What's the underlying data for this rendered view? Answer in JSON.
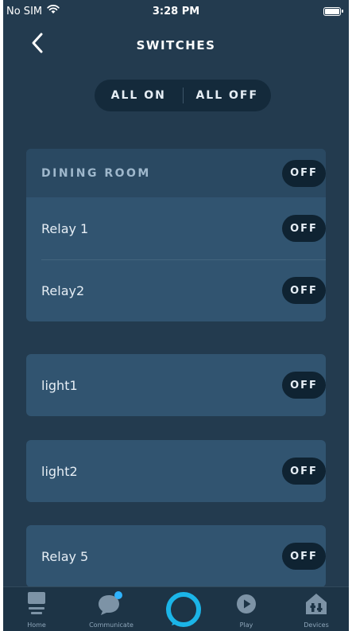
{
  "status_bar": {
    "carrier": "No SIM",
    "time": "3:28 PM"
  },
  "nav": {
    "title": "SWITCHES"
  },
  "all_controls": {
    "all_on": "ALL ON",
    "all_off": "ALL OFF"
  },
  "groups": [
    {
      "title": "DINING ROOM",
      "state": "OFF",
      "items": [
        {
          "label": "Relay 1",
          "state": "OFF"
        },
        {
          "label": "Relay2",
          "state": "OFF"
        }
      ]
    }
  ],
  "devices": [
    {
      "label": "light1",
      "state": "OFF"
    },
    {
      "label": "light2",
      "state": "OFF"
    },
    {
      "label": "Relay 5",
      "state": "OFF"
    }
  ],
  "tabbar": {
    "home": "Home",
    "communicate": "Communicate",
    "play": "Play",
    "devices": "Devices"
  },
  "colors": {
    "background": "#233b4f",
    "card": "#315470",
    "card_header": "#2a4962",
    "toggle": "#0f2332",
    "alexa_ring": "#1bb5e8",
    "notification_dot": "#2fb3ff"
  },
  "icons": [
    "back-chevron-icon",
    "wifi-icon",
    "battery-icon",
    "home-icon",
    "communicate-icon",
    "alexa-icon",
    "play-icon",
    "devices-icon"
  ]
}
